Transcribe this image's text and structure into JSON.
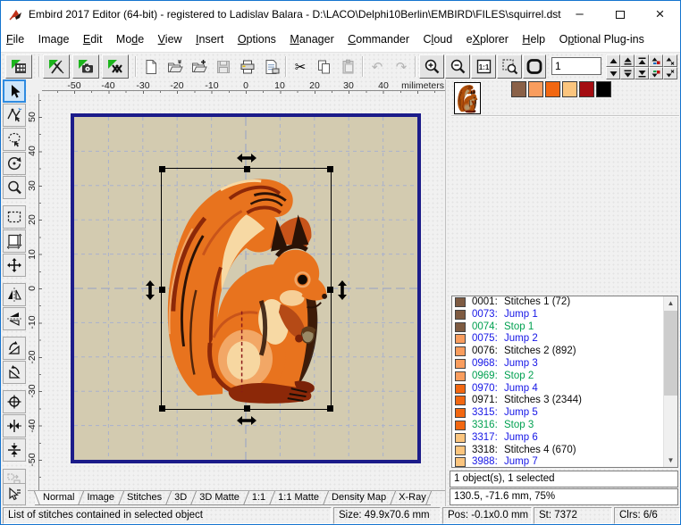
{
  "window": {
    "title": "Embird 2017 Editor (64-bit) - registered to Ladislav Balara - D:\\LACO\\Delphi10Berlin\\EMBIRD\\FILES\\squirrel.dst",
    "minimize": "–",
    "close": "×"
  },
  "menubar": {
    "items": [
      {
        "pre": "",
        "u": "F",
        "post": "ile"
      },
      {
        "pre": "Ima",
        "u": "g",
        "post": "e"
      },
      {
        "pre": "",
        "u": "E",
        "post": "dit"
      },
      {
        "pre": "Mo",
        "u": "d",
        "post": "e"
      },
      {
        "pre": "",
        "u": "V",
        "post": "iew"
      },
      {
        "pre": "",
        "u": "I",
        "post": "nsert"
      },
      {
        "pre": "",
        "u": "O",
        "post": "ptions"
      },
      {
        "pre": "",
        "u": "M",
        "post": "anager"
      },
      {
        "pre": "",
        "u": "C",
        "post": "ommander"
      },
      {
        "pre": "C",
        "u": "l",
        "post": "oud"
      },
      {
        "pre": "e",
        "u": "X",
        "post": "plorer"
      },
      {
        "pre": "",
        "u": "H",
        "post": "elp"
      },
      {
        "pre": "O",
        "u": "p",
        "post": "tional Plug-ins"
      }
    ]
  },
  "toolbar": {
    "spin_value": "1"
  },
  "rulers": {
    "h": [
      "-50",
      "-40",
      "-30",
      "-20",
      "-10",
      "0",
      "10",
      "20",
      "30",
      "40"
    ],
    "v": [
      "50",
      "40",
      "30",
      "20",
      "10",
      "0",
      "-10",
      "-20",
      "-30",
      "-40",
      "-50"
    ],
    "unit": "milimeters"
  },
  "palette": {
    "colors": [
      "#8a6148",
      "#f99d5e",
      "#f26711",
      "#fbc57e",
      "#a50d12",
      "#000000"
    ]
  },
  "stitch_list": {
    "items": [
      {
        "num": "0001:",
        "label": "Stitches 1 (72)",
        "chip": "#7e5b42",
        "fg": "#0a0a0a"
      },
      {
        "num": "0073:",
        "label": "Jump 1",
        "chip": "#7e5b42",
        "fg": "#1616e6"
      },
      {
        "num": "0074:",
        "label": "Stop 1",
        "chip": "#7e5b42",
        "fg": "#00a050"
      },
      {
        "num": "0075:",
        "label": "Jump 2",
        "chip": "#f99d5e",
        "fg": "#1616e6"
      },
      {
        "num": "0076:",
        "label": "Stitches 2 (892)",
        "chip": "#f99d5e",
        "fg": "#0a0a0a"
      },
      {
        "num": "0968:",
        "label": "Jump 3",
        "chip": "#f99d5e",
        "fg": "#1616e6"
      },
      {
        "num": "0969:",
        "label": "Stop 2",
        "chip": "#f99d5e",
        "fg": "#00a050"
      },
      {
        "num": "0970:",
        "label": "Jump 4",
        "chip": "#f26711",
        "fg": "#1616e6"
      },
      {
        "num": "0971:",
        "label": "Stitches 3 (2344)",
        "chip": "#f26711",
        "fg": "#0a0a0a"
      },
      {
        "num": "3315:",
        "label": "Jump 5",
        "chip": "#f26711",
        "fg": "#1616e6"
      },
      {
        "num": "3316:",
        "label": "Stop 3",
        "chip": "#f26711",
        "fg": "#00a050"
      },
      {
        "num": "3317:",
        "label": "Jump 6",
        "chip": "#fbc57e",
        "fg": "#1616e6"
      },
      {
        "num": "3318:",
        "label": "Stitches 4 (670)",
        "chip": "#fbc57e",
        "fg": "#0a0a0a"
      },
      {
        "num": "3988:",
        "label": "Jump 7",
        "chip": "#fbc57e",
        "fg": "#1616e6"
      }
    ]
  },
  "selection_info": {
    "objects": "1 object(s), 1 selected",
    "coords": "130.5, -71.6 mm, 75%"
  },
  "tabs": {
    "items": [
      "Normal",
      "Image",
      "Stitches",
      "3D",
      "3D Matte",
      "1:1",
      "1:1 Matte",
      "Density Map",
      "X-Ray"
    ]
  },
  "statusbar": {
    "hint": "List of stitches contained in selected object",
    "size": "Size: 49.9x70.6 mm",
    "pos": "Pos: -0.1x0.0 mm",
    "st": "St: 7372",
    "clrs": "Clrs: 6/6"
  }
}
